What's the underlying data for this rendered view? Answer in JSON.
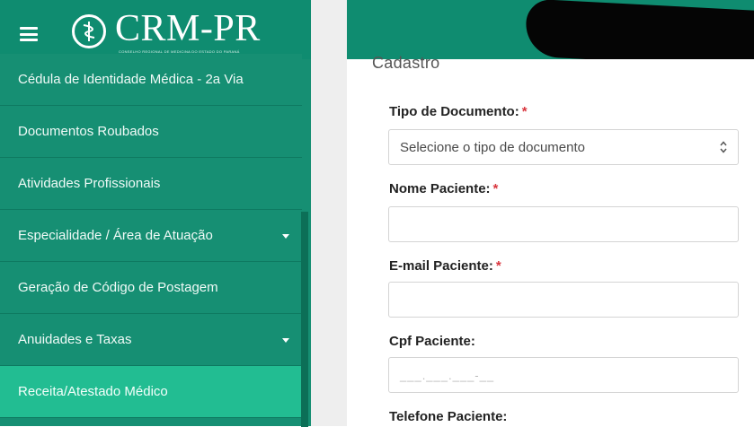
{
  "header": {
    "logo_text": "CRM-PR",
    "logo_subtitle": "CONSELHO REGIONAL DE MEDICINA DO ESTADO DO PARANÁ",
    "brand_color": "#0f8c70"
  },
  "sidebar": {
    "items": [
      {
        "label": "Cédula de Identidade Médica - 2a Via",
        "has_submenu": false,
        "active": false
      },
      {
        "label": "Documentos Roubados",
        "has_submenu": false,
        "active": false
      },
      {
        "label": "Atividades Profissionais",
        "has_submenu": false,
        "active": false
      },
      {
        "label": "Especialidade / Área de Atuação",
        "has_submenu": true,
        "active": false
      },
      {
        "label": "Geração de Código de Postagem",
        "has_submenu": false,
        "active": false
      },
      {
        "label": "Anuidades e Taxas",
        "has_submenu": true,
        "active": false
      },
      {
        "label": "Receita/Atestado Médico",
        "has_submenu": false,
        "active": true
      }
    ]
  },
  "form": {
    "section_title": "Cadastro",
    "required_mark": "*",
    "tipo_documento": {
      "label": "Tipo de Documento:",
      "required": true,
      "selected": "Selecione o tipo de documento"
    },
    "nome_paciente": {
      "label": "Nome Paciente:",
      "required": true,
      "value": ""
    },
    "email_paciente": {
      "label": "E-mail Paciente:",
      "required": true,
      "value": ""
    },
    "cpf_paciente": {
      "label": "Cpf Paciente:",
      "required": false,
      "mask": "___.___.___-__"
    },
    "telefone_paciente": {
      "label": "Telefone Paciente:",
      "required": false
    }
  }
}
